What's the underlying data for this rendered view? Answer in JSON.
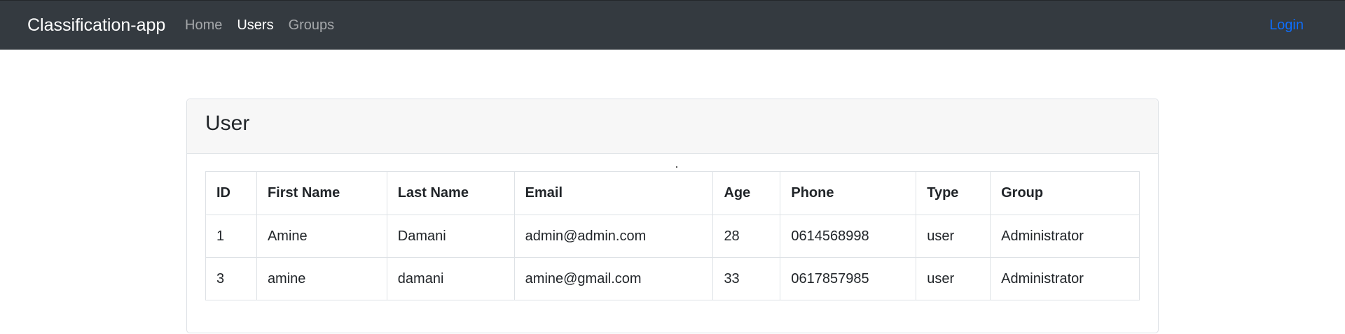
{
  "navbar": {
    "brand": "Classification-app",
    "links": [
      {
        "label": "Home",
        "active": false
      },
      {
        "label": "Users",
        "active": true
      },
      {
        "label": "Groups",
        "active": false
      }
    ],
    "login": "Login"
  },
  "card": {
    "title": "User",
    "table": {
      "headers": [
        "ID",
        "First Name",
        "Last Name",
        "Email",
        "Age",
        "Phone",
        "Type",
        "Group"
      ],
      "rows": [
        [
          "1",
          "Amine",
          "Damani",
          "admin@admin.com",
          "28",
          "0614568998",
          "user",
          "Administrator"
        ],
        [
          "3",
          "amine",
          "damani",
          "amine@gmail.com",
          "33",
          "0617857985",
          "user",
          "Administrator"
        ]
      ]
    }
  },
  "colors": {
    "navbar_bg": "#343a40",
    "link_active": "#ffffff",
    "link_muted": "rgba(255,255,255,0.55)",
    "login": "#0d6efd",
    "card_header_bg": "#f7f7f7"
  }
}
